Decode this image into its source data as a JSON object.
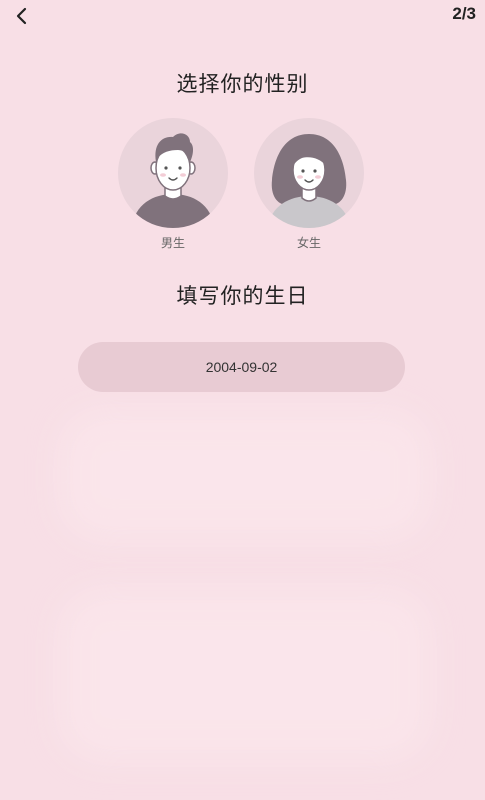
{
  "header": {
    "back_icon": "chevron-left-icon",
    "step": "2/3"
  },
  "gender": {
    "title": "选择你的性别",
    "options": [
      {
        "label": "男生",
        "icon": "male-avatar-icon"
      },
      {
        "label": "女生",
        "icon": "female-avatar-icon"
      }
    ]
  },
  "birthday": {
    "title": "填写你的生日",
    "value": "2004-09-02"
  },
  "colors": {
    "background": "#f8dfe6",
    "avatar_bg": "#ead4db",
    "field_bg": "#e8cbd3",
    "hair": "#80727c",
    "skin": "#ffffff",
    "male_shirt": "#80727c",
    "female_shirt": "#c9c7cb"
  }
}
